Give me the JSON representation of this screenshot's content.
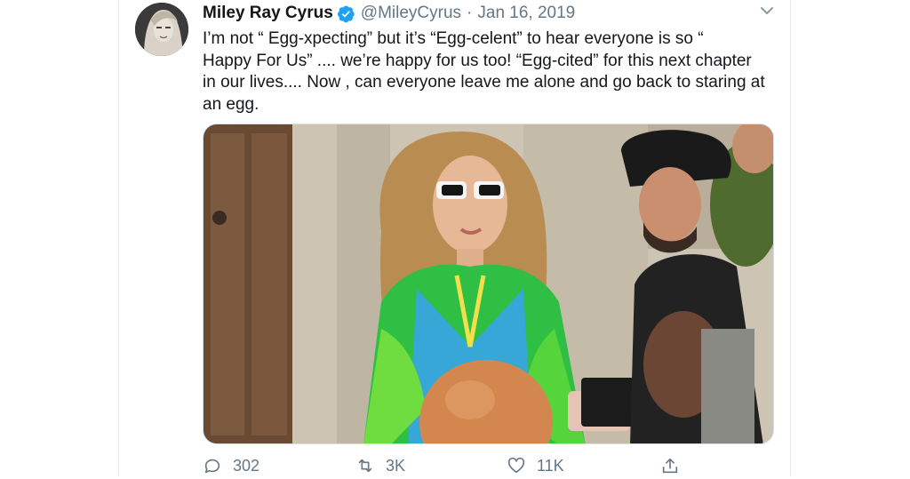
{
  "tweet": {
    "display_name": "Miley Ray Cyrus",
    "handle": "@MileyCyrus",
    "separator": "·",
    "date": "Jan 16, 2019",
    "text": "I’m not “ Egg-xpecting” but it’s “Egg-celent” to hear everyone is so “\nHappy For Us” .... we’re happy for us too! “Egg-cited” for this next chapter\nin our lives.... Now , can everyone leave me alone and go back to staring at\nan egg.",
    "verified": true
  },
  "actions": {
    "reply_count": "302",
    "retweet_count": "3K",
    "like_count": "11K"
  },
  "icons": [
    "verified-badge-icon",
    "chevron-down-icon",
    "reply-icon",
    "retweet-icon",
    "like-icon",
    "share-icon"
  ],
  "colors": {
    "text": "#14171a",
    "secondary": "#657786",
    "verified": "#1da1f2",
    "divider": "#e6ecf0"
  }
}
